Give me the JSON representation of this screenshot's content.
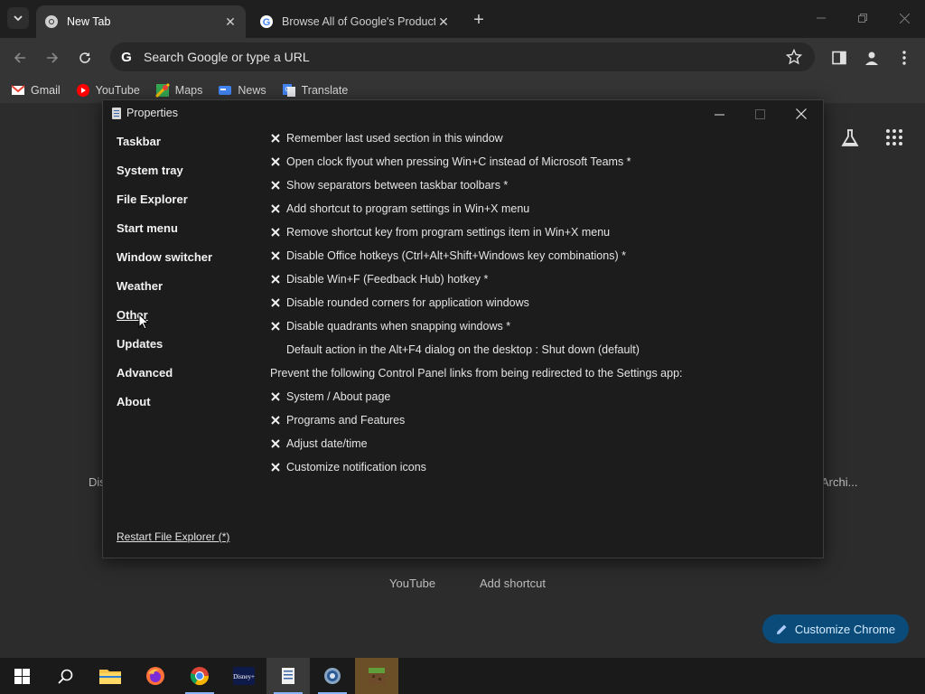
{
  "browser": {
    "tabs": [
      {
        "title": "New Tab",
        "active": true
      },
      {
        "title": "Browse All of Google's Products",
        "active": false
      }
    ],
    "omnibox_placeholder": "Search Google or type a URL",
    "bookmarks": [
      {
        "label": "Gmail",
        "icon": "gmail-icon"
      },
      {
        "label": "YouTube",
        "icon": "youtube-icon"
      },
      {
        "label": "Maps",
        "icon": "maps-icon"
      },
      {
        "label": "News",
        "icon": "news-icon"
      },
      {
        "label": "Translate",
        "icon": "translate-icon"
      }
    ]
  },
  "ntp": {
    "shortcuts_visible": [
      "Dis",
      "Archi...",
      "YouTube",
      "Add shortcut"
    ],
    "customize_label": "Customize Chrome"
  },
  "dialog": {
    "title": "Properties",
    "sections": [
      "Taskbar",
      "System tray",
      "File Explorer",
      "Start menu",
      "Window switcher",
      "Weather",
      "Other",
      "Updates",
      "Advanced",
      "About"
    ],
    "selected_section": "Other",
    "options": [
      {
        "label": "Remember last used section in this window",
        "checked": true
      },
      {
        "label": "Open clock flyout when pressing Win+C instead of Microsoft Teams *",
        "checked": true
      },
      {
        "label": "Show separators between taskbar toolbars *",
        "checked": true
      },
      {
        "label": "Add shortcut to program settings in Win+X menu",
        "checked": true
      },
      {
        "label": "Remove shortcut key from program settings item in Win+X menu",
        "checked": true
      },
      {
        "label": "Disable Office hotkeys (Ctrl+Alt+Shift+Windows key combinations) *",
        "checked": true
      },
      {
        "label": "Disable Win+F (Feedback Hub) hotkey *",
        "checked": true
      },
      {
        "label": "Disable rounded corners for application windows",
        "checked": true
      },
      {
        "label": "Disable quadrants when snapping windows *",
        "checked": true
      },
      {
        "label": "Default action in the Alt+F4 dialog on the desktop : Shut down (default)",
        "checked": null
      },
      {
        "label": "Prevent the following Control Panel links from being redirected to the Settings app:",
        "heading": true
      },
      {
        "label": "System / About page",
        "checked": true
      },
      {
        "label": "Programs and Features",
        "checked": true
      },
      {
        "label": "Adjust date/time",
        "checked": true
      },
      {
        "label": "Customize notification icons",
        "checked": true
      }
    ],
    "footer_link": "Restart File Explorer (*)"
  },
  "taskbar": {
    "items": [
      "windows-start-icon",
      "search-icon",
      "file-explorer-icon",
      "firefox-icon",
      "chrome-icon",
      "disney-plus-icon",
      "properties-app-icon",
      "settings-app-icon",
      "minecraft-icon"
    ],
    "active_index": 6
  }
}
